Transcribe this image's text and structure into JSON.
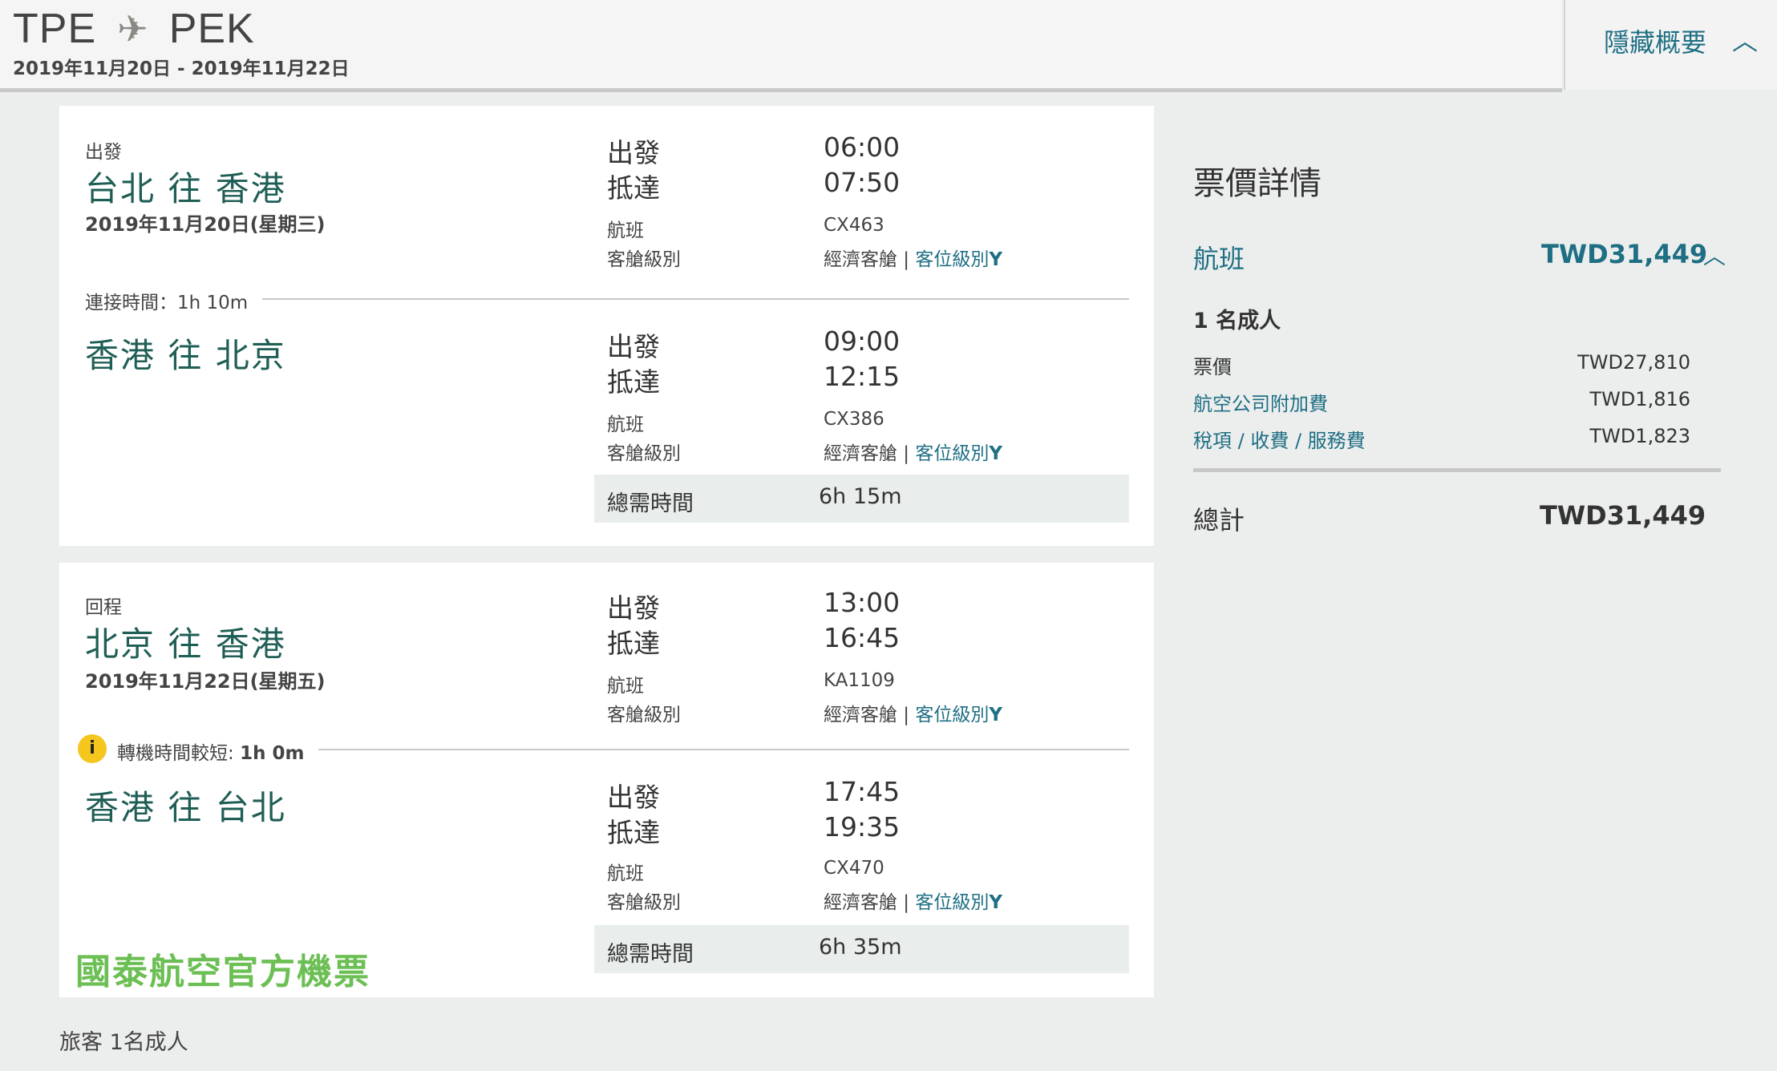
{
  "header": {
    "origin": "TPE",
    "destination": "PEK",
    "dates": "2019年11月20日 - 2019年11月22日",
    "hide_summary_label": "隱藏概要"
  },
  "outbound": {
    "direction_label": "出發",
    "route": "台北 往 香港",
    "date": "2019年11月20日(星期三)",
    "connection_text": "連接時間：1h 10m",
    "leg1": {
      "depart_label": "出發",
      "depart_time": "06:00",
      "arrive_label": "抵達",
      "arrive_time": "07:50",
      "flight_label": "航班",
      "flight_no": "CX463",
      "cabin_label": "客艙級別",
      "cabin": "經濟客艙",
      "class_link": "客位級別",
      "class_code": "Y"
    },
    "leg2": {
      "route": "香港 往 北京",
      "depart_label": "出發",
      "depart_time": "09:00",
      "arrive_label": "抵達",
      "arrive_time": "12:15",
      "flight_label": "航班",
      "flight_no": "CX386",
      "cabin_label": "客艙級別",
      "cabin": "經濟客艙",
      "class_link": "客位級別",
      "class_code": "Y"
    },
    "total_label": "總需時間",
    "total_time": "6h 15m"
  },
  "inbound": {
    "direction_label": "回程",
    "route": "北京 往 香港",
    "date": "2019年11月22日(星期五)",
    "connection_label": "轉機時間較短:",
    "connection_time": "1h 0m",
    "warning_icon": "i",
    "leg1": {
      "depart_label": "出發",
      "depart_time": "13:00",
      "arrive_label": "抵達",
      "arrive_time": "16:45",
      "flight_label": "航班",
      "flight_no": "KA1109",
      "cabin_label": "客艙級別",
      "cabin": "經濟客艙",
      "class_link": "客位級別",
      "class_code": "Y"
    },
    "leg2": {
      "route": "香港 往 台北",
      "depart_label": "出發",
      "depart_time": "17:45",
      "arrive_label": "抵達",
      "arrive_time": "19:35",
      "flight_label": "航班",
      "flight_no": "CX470",
      "cabin_label": "客艙級別",
      "cabin": "經濟客艙",
      "class_link": "客位級別",
      "class_code": "Y"
    },
    "total_label": "總需時間",
    "total_time": "6h 35m",
    "watermark": "國泰航空官方機票"
  },
  "passengers": "旅客   1名成人",
  "price": {
    "title": "票價詳情",
    "flight_label": "航班",
    "flight_total": "TWD31,449",
    "adult_count": "1 名成人",
    "rows": [
      {
        "label": "票價",
        "value": "TWD27,810"
      },
      {
        "label": "航空公司附加費",
        "value": "TWD1,816"
      },
      {
        "label": "稅項 / 收費 / 服務費",
        "value": "TWD1,823"
      }
    ],
    "grand_label": "總計",
    "grand_value": "TWD31,449"
  },
  "colors": {
    "accent": "#1f6f84",
    "route_green": "#1f5e55",
    "warning": "#f4c61e",
    "watermark": "#6cbf54",
    "background": "#eceeed"
  },
  "icons": {
    "plane": "airplane-icon",
    "chevron": "chevron-up-icon",
    "warning": "info-warning-icon"
  }
}
